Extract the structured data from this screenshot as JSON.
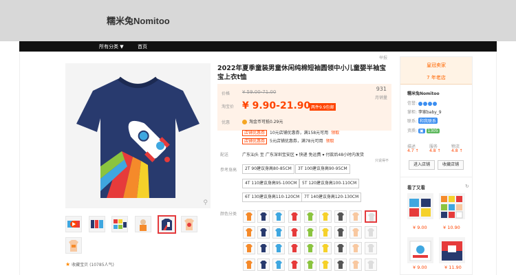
{
  "shop": {
    "name": "糯米兔Nomitoo"
  },
  "nav": {
    "items": [
      "所有分类 ▼",
      "首页"
    ]
  },
  "product": {
    "title": "2022年夏季童装男童休闲纯棉短袖圆领中小儿童婴半袖宝宝上衣t恤",
    "report": "举报",
    "price_label": "价格",
    "original_price": "¥ 59.00-71.00",
    "promo_label": "淘宝价",
    "promo_price": "¥ 9.90-21.90",
    "promo_tag": "两件9.9包邮",
    "sold_count": "931",
    "sold_label": "月销量",
    "offers_label": "优惠",
    "coin_text": "淘金币可抵0.29元",
    "coupons": [
      {
        "tag": "店铺优惠券",
        "text": "10元店铺优惠券，满158元可用",
        "action": "领取"
      },
      {
        "tag": "店铺优惠券",
        "text": "5元店铺优惠券，满78元可用",
        "action": "领取"
      }
    ],
    "shipping_label": "配送",
    "shipping_text": "广东汕头 至  广东深圳宝安区 ▾    快递 免运费 ▾    付款后48小时内发货",
    "shipping_note": "只说得不",
    "size_label": "参考身高",
    "sizes": [
      "2T 90建议身高80-85CM",
      "3T 100建议身高90-95CM",
      "4T 110建议身高95-100CM",
      "5T 120建议身高100-110CM",
      "6T 130建议身高110-120CM",
      "7T 140建议身高120-130CM"
    ],
    "color_label": "颜色分类",
    "favorite_text": "收藏宝贝 (10785人气)"
  },
  "seller": {
    "badge": "皇冠卖家",
    "years": "7 年老店",
    "name": "糯米兔Nomitoo",
    "credit_label": "信誉:",
    "keeper_label": "掌柜:",
    "keeper": "李家baby_9",
    "contact_label": "联系:",
    "contact": "和我联系",
    "qual_label": "资质:",
    "qual_value": "1305",
    "scores": [
      {
        "label": "描述",
        "value": "4.7 ↑"
      },
      {
        "label": "服务",
        "value": "4.8 ↑"
      },
      {
        "label": "物流",
        "value": "4.8 ↑"
      }
    ],
    "enter_shop": "进入店铺",
    "favorite_shop": "收藏店铺"
  },
  "recommend": {
    "title": "看了又看",
    "items": [
      {
        "price": "¥ 9.00"
      },
      {
        "price": "¥ 10.90"
      },
      {
        "price": "¥ 9.00"
      },
      {
        "price": "¥ 11.90"
      }
    ]
  },
  "colors": {
    "accent": "#ff4400",
    "nav": "#111111",
    "header": "#d8d8d8",
    "seller_bg": "#fff3e5"
  }
}
